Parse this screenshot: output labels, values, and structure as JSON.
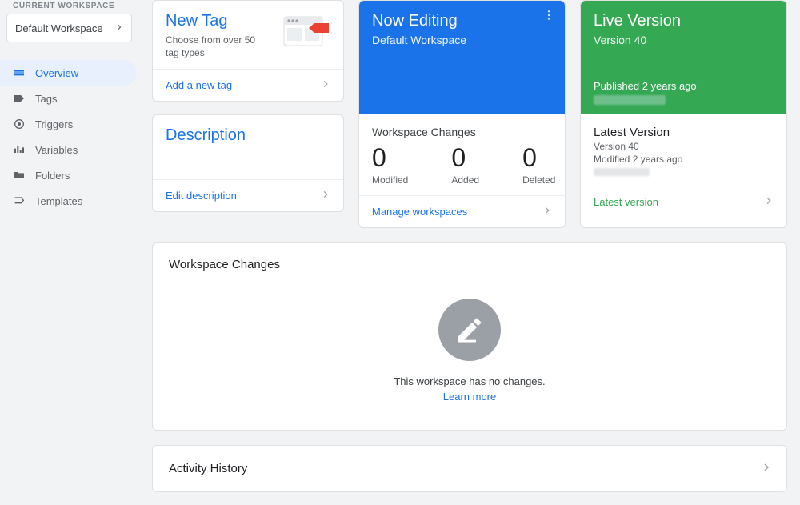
{
  "sidebar": {
    "current_workspace_label": "CURRENT WORKSPACE",
    "workspace_name": "Default Workspace",
    "items": [
      {
        "label": "Overview"
      },
      {
        "label": "Tags"
      },
      {
        "label": "Triggers"
      },
      {
        "label": "Variables"
      },
      {
        "label": "Folders"
      },
      {
        "label": "Templates"
      }
    ]
  },
  "newtag": {
    "title": "New Tag",
    "subtitle": "Choose from over 50 tag types",
    "cta": "Add a new tag"
  },
  "description": {
    "title": "Description",
    "cta": "Edit description"
  },
  "editing": {
    "title": "Now Editing",
    "workspace": "Default Workspace",
    "changes_title": "Workspace Changes",
    "changes": [
      {
        "num": "0",
        "label": "Modified"
      },
      {
        "num": "0",
        "label": "Added"
      },
      {
        "num": "0",
        "label": "Deleted"
      }
    ],
    "cta": "Manage workspaces"
  },
  "live": {
    "title": "Live Version",
    "version": "Version 40",
    "published": "Published 2 years ago",
    "latest_title": "Latest Version",
    "latest_version": "Version 40",
    "latest_modified": "Modified 2 years ago",
    "cta": "Latest version"
  },
  "ws_changes": {
    "title": "Workspace Changes",
    "empty_text": "This workspace has no changes.",
    "learn_more": "Learn more"
  },
  "activity": {
    "title": "Activity History"
  }
}
